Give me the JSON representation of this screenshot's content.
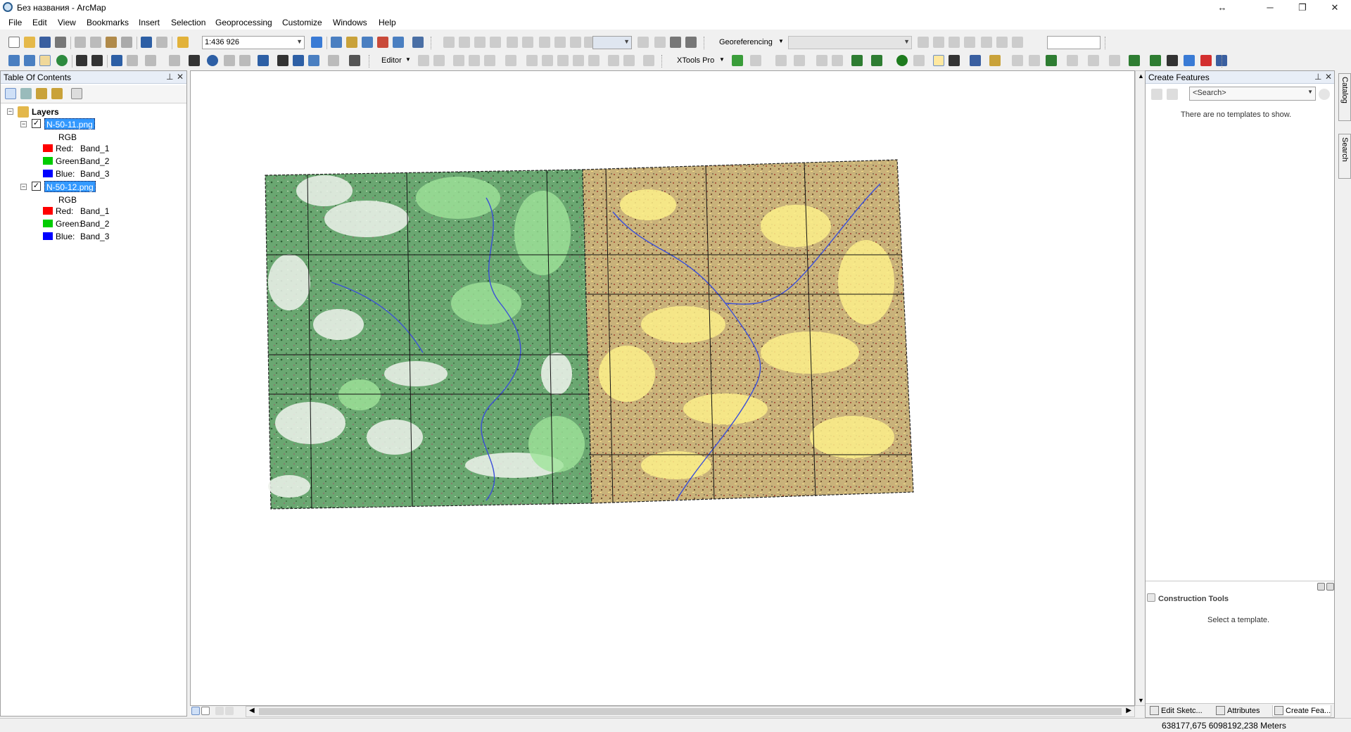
{
  "window": {
    "title": "Без названия - ArcMap",
    "controls": {
      "minimize": "─",
      "maximize": "❐",
      "close": "✕",
      "resize": "↔"
    }
  },
  "menu": [
    "File",
    "Edit",
    "View",
    "Bookmarks",
    "Insert",
    "Selection",
    "Geoprocessing",
    "Customize",
    "Windows",
    "Help"
  ],
  "toolbar": {
    "scale": "1:436 926",
    "georeferencing_label": "Georeferencing",
    "editor_label": "Editor",
    "xtools_label": "XTools Pro"
  },
  "toc": {
    "title": "Table Of Contents",
    "root": "Layers",
    "layers": [
      {
        "name": "N-50-11.png",
        "checked": true,
        "renderer": "RGB",
        "bands": [
          {
            "label": "Red:",
            "band": "Band_1",
            "color": "#ff0000"
          },
          {
            "label": "Green:",
            "band": "Band_2",
            "color": "#00cc00"
          },
          {
            "label": "Blue:",
            "band": "Band_3",
            "color": "#0000ff"
          }
        ]
      },
      {
        "name": "N-50-12.png",
        "checked": true,
        "renderer": "RGB",
        "bands": [
          {
            "label": "Red:",
            "band": "Band_1",
            "color": "#ff0000"
          },
          {
            "label": "Green:",
            "band": "Band_2",
            "color": "#00cc00"
          },
          {
            "label": "Blue:",
            "band": "Band_3",
            "color": "#0000ff"
          }
        ]
      }
    ]
  },
  "create_features": {
    "title": "Create Features",
    "search_placeholder": "<Search>",
    "no_templates": "There are no templates to show.",
    "construction_tools_title": "Construction Tools",
    "select_template": "Select a template.",
    "tabs": [
      "Edit Sketc...",
      "Attributes",
      "Create Fea..."
    ]
  },
  "side_tabs": [
    "Catalog",
    "Search"
  ],
  "status": {
    "coordinates": "638177,675  6098192,238 Meters"
  },
  "map": {
    "green_sheet_color": "#6aa771",
    "tan_sheet_color": "#c9b27a"
  }
}
